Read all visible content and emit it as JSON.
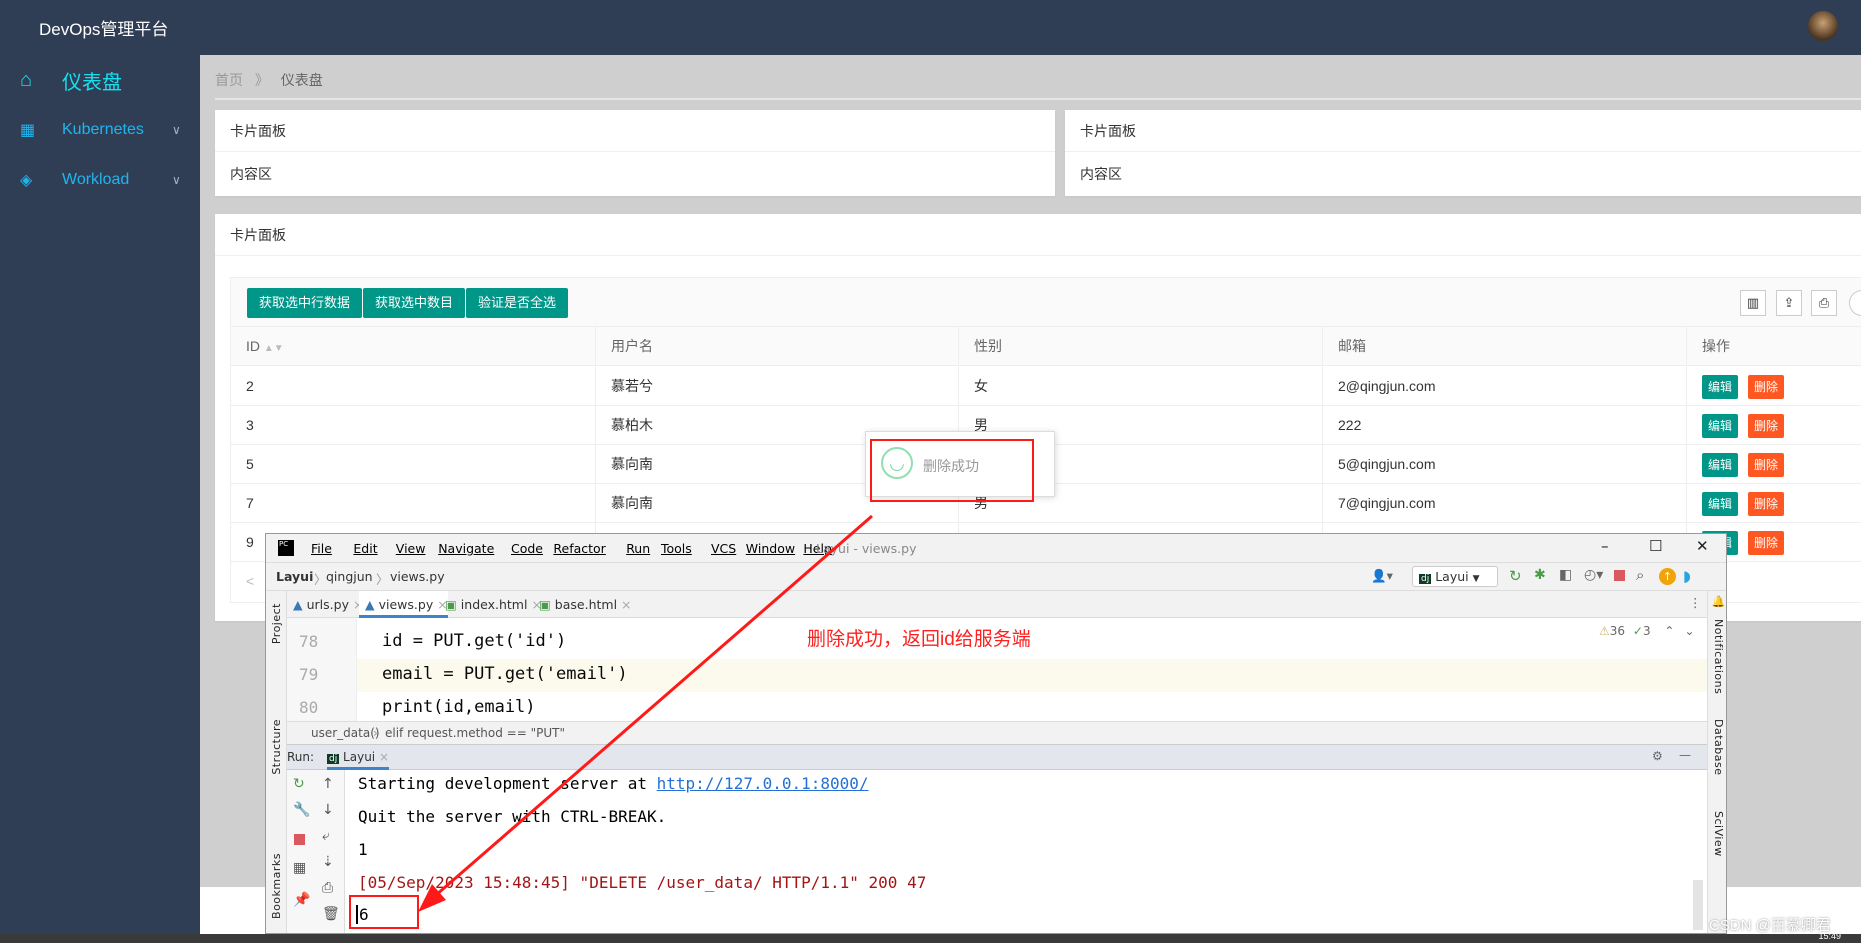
{
  "header": {
    "title": "DevOps管理平台"
  },
  "sidebar": {
    "items": [
      {
        "label": "仪表盘",
        "icon": "home-icon",
        "active": true
      },
      {
        "label": "Kubernetes",
        "icon": "apps-icon"
      },
      {
        "label": "Workload",
        "icon": "layers-icon"
      }
    ]
  },
  "breadcrumb": {
    "home": "首页",
    "sep": "》",
    "current": "仪表盘"
  },
  "cards": [
    {
      "title": "卡片面板",
      "body": "内容区"
    },
    {
      "title": "卡片面板",
      "body": "内容区"
    },
    {
      "title": "卡片面板"
    }
  ],
  "table": {
    "buttons": [
      "获取选中行数据",
      "获取选中数目",
      "验证是否全选"
    ],
    "columns": [
      "ID",
      "用户名",
      "性别",
      "邮箱",
      "操作"
    ],
    "rows": [
      {
        "id": "2",
        "name": "慕若兮",
        "gender": "女",
        "email": "2@qingjun.com"
      },
      {
        "id": "3",
        "name": "慕柏木",
        "gender": "男",
        "email": "222"
      },
      {
        "id": "5",
        "name": "慕向南",
        "gender": "",
        "email": "5@qingjun.com"
      },
      {
        "id": "7",
        "name": "慕向南",
        "gender": "男",
        "email": "7@qingjun.com"
      },
      {
        "id": "9",
        "name": "",
        "gender": "",
        "email": ""
      }
    ],
    "edit_label": "编辑",
    "delete_label": "删除",
    "prev": "<",
    "colors": {
      "primary": "#009688",
      "danger": "#ff5722"
    }
  },
  "toast": {
    "text": "删除成功",
    "icon": "smile-icon"
  },
  "ide": {
    "menu": [
      "File",
      "Edit",
      "View",
      "Navigate",
      "Code",
      "Refactor",
      "Run",
      "Tools",
      "VCS",
      "Window",
      "Help"
    ],
    "window_title": "Layui - views.py",
    "nav": [
      "Layui",
      "qingjun",
      "views.py"
    ],
    "run_config": "Layui",
    "tabs": [
      "urls.py",
      "views.py",
      "index.html",
      "base.html"
    ],
    "left_tools": [
      "Project",
      "Structure",
      "Bookmarks"
    ],
    "right_tools": [
      "Notifications",
      "Database",
      "SciView"
    ],
    "inspections": {
      "warnings": "36",
      "ok": "3"
    },
    "lines": [
      {
        "num": "78",
        "code": "id = PUT.get('id')"
      },
      {
        "num": "79",
        "code": "email = PUT.get('email')"
      },
      {
        "num": "80",
        "code": "print(id,email)"
      }
    ],
    "breadcrumb": [
      "user_data()",
      "elif request.method == \"PUT\""
    ],
    "run_label": "Run:",
    "run_tab": "Layui",
    "console": {
      "l1_prefix": "Starting development server at ",
      "l1_link": "http://127.0.0.1:8000/",
      "l2": "Quit the server with CTRL-BREAK.",
      "l3": "1",
      "l4": "[05/Sep/2023 15:48:45] \"DELETE /user_data/ HTTP/1.1\" 200 47",
      "l5": "6"
    }
  },
  "annotation": "删除成功，返回id给服务端",
  "watermark": "CSDN @百慕卿君",
  "taskbar": {
    "clock": "15:49"
  }
}
